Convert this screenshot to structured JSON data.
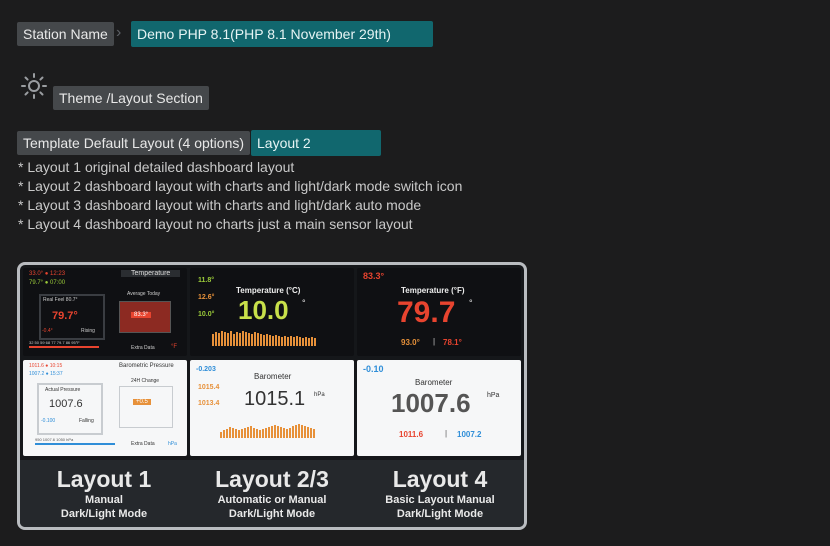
{
  "station": {
    "label": "Station Name",
    "value": "Demo PHP 8.1(PHP 8.1 November 29th)"
  },
  "theme": {
    "label": "Theme /Layout Section",
    "icon": "gear-icon"
  },
  "template": {
    "label": "Template Default Layout (4 options)",
    "value": "Layout 2"
  },
  "notes": [
    "* Layout 1 original detailed dashboard layout",
    "* Layout 2 dashboard layout with charts and light/dark mode switch icon",
    "* Layout 3 dashboard layout with charts and light/dark auto mode",
    "* Layout 4 dashboard layout no charts just a main sensor layout"
  ],
  "preview": {
    "l1_dark": {
      "header": "Temperature",
      "feel": "Real Feel 80.7°",
      "main": "79.7°",
      "today": "Average Today",
      "avg": "83.3°",
      "rising": "Rising",
      "extra": "Extra Data",
      "unit": "°F",
      "s1": "33.0° ● 12:23",
      "s2": "79.7° ● 07:00",
      "delta": "-0.4°",
      "scale": "32 50 59 68 77 79.7 86 95°F"
    },
    "l2_dark": {
      "title": "Temperature (°C)",
      "main": "10.0",
      "deg": "°",
      "v1": "11.8°",
      "v2": "12.6°",
      "v3": "10.0°"
    },
    "l4_dark": {
      "corner": "83.3°",
      "title": "Temperature (°F)",
      "main": "79.7",
      "deg": "°",
      "low": "93.0°",
      "sep": "|",
      "high": "78.1°"
    },
    "l1_light": {
      "header": "Barometric Pressure",
      "s1": "1011.6 ● 10:15",
      "s2": "1007.2 ● 15:37",
      "box": "Actual Pressure",
      "main": "1007.6",
      "delta": "-0.100",
      "falling": "Falling",
      "h24": "24H Change",
      "chg": "+0.5",
      "extra": "Extra Data",
      "unit": "hPa",
      "scale": "950 1007.6 1050 hPa"
    },
    "l2_light": {
      "title": "Barometer",
      "main": "1015.1",
      "unit": "hPa",
      "v1": "-0.203",
      "v2": "1015.4",
      "v3": "1013.4"
    },
    "l4_light": {
      "corner": "-0.10",
      "title": "Barometer",
      "main": "1007.6",
      "unit": "hPa",
      "low": "1011.6",
      "sep": "|",
      "high": "1007.2"
    },
    "captions": [
      {
        "title": "Layout 1",
        "line1": "Manual",
        "line2": "Dark/Light Mode"
      },
      {
        "title": "Layout 2/3",
        "line1": "Automatic or Manual",
        "line2": "Dark/Light Mode"
      },
      {
        "title": "Layout 4",
        "line1": "Basic Layout Manual",
        "line2": "Dark/Light Mode"
      }
    ],
    "colors": {
      "red": "#e8442f",
      "orange": "#e7913a",
      "green": "#9ccc3a",
      "blue": "#2f8ed8",
      "teal": "#11676e"
    }
  }
}
